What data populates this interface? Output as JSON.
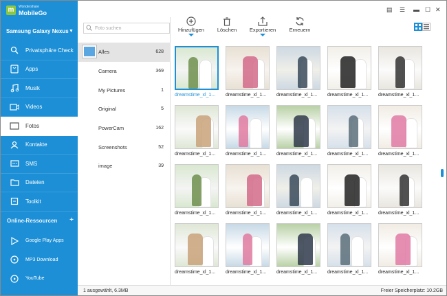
{
  "brand": {
    "small": "Wondershare",
    "big": "MobileGo"
  },
  "device": "Samsung Galaxy Nexus",
  "nav": [
    {
      "label": "Privatsphäre Check",
      "icon": "shield-icon"
    },
    {
      "label": "Apps",
      "icon": "apps-icon"
    },
    {
      "label": "Musik",
      "icon": "music-icon"
    },
    {
      "label": "Videos",
      "icon": "video-icon"
    },
    {
      "label": "Fotos",
      "icon": "photo-icon"
    },
    {
      "label": "Kontakte",
      "icon": "contacts-icon"
    },
    {
      "label": "SMS",
      "icon": "sms-icon"
    },
    {
      "label": "Dateien",
      "icon": "folder-icon"
    },
    {
      "label": "Toolkit",
      "icon": "toolkit-icon"
    }
  ],
  "online": {
    "title": "Online-Ressourcen",
    "items": [
      {
        "label": "Google Play Apps",
        "icon": "google-play-icon"
      },
      {
        "label": "MP3 Download",
        "icon": "mp3-icon"
      },
      {
        "label": "YouTube",
        "icon": "youtube-icon"
      }
    ]
  },
  "search": {
    "placeholder": "Foto suchen"
  },
  "albums": [
    {
      "name": "Alles",
      "count": "628"
    },
    {
      "name": "Camera",
      "count": "369"
    },
    {
      "name": "My Pictures",
      "count": "1"
    },
    {
      "name": "Original",
      "count": "5"
    },
    {
      "name": "PowerCam",
      "count": "162"
    },
    {
      "name": "Screenshots",
      "count": "52"
    },
    {
      "name": "image",
      "count": "39"
    }
  ],
  "toolbar": {
    "add": "Hinzufügen",
    "delete": "Löschen",
    "export": "Exportieren",
    "refresh": "Erneuern"
  },
  "photos": {
    "caption": "dreamstime_xl_1..."
  },
  "status": {
    "left": "1 ausgewählt, 6.3MB",
    "right": "Freier Speicherplatz: 10.2GB"
  },
  "colors": {
    "accent": "#1c8fd6"
  }
}
